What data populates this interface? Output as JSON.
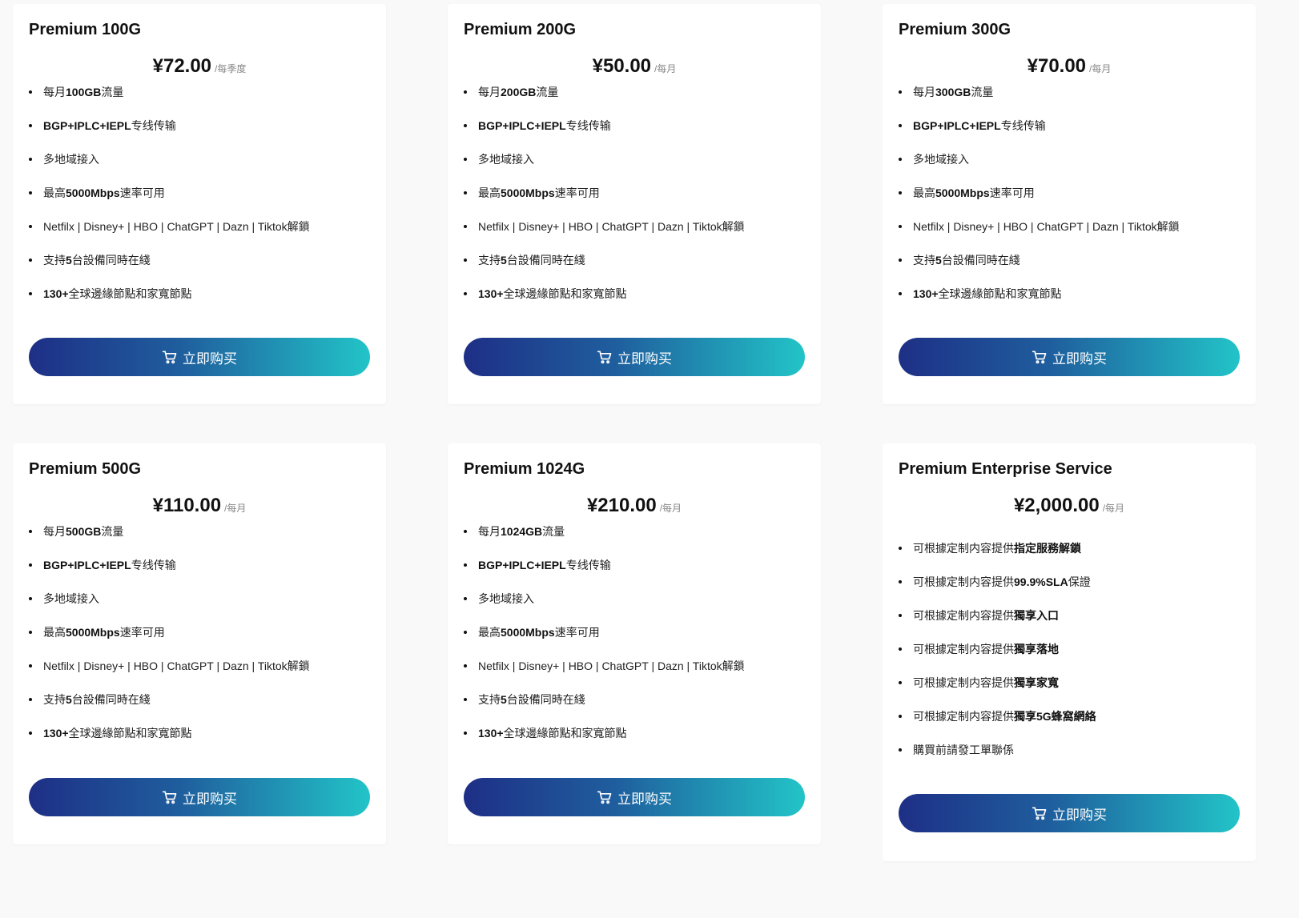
{
  "colors": {
    "button_gradient_start": "#1e2f86",
    "button_gradient_end": "#22c4c8",
    "background": "#f9f9f9",
    "card": "#ffffff"
  },
  "buy_label": "立即购买",
  "plans": [
    {
      "title": "Premium 100G",
      "price": "¥72.00",
      "period": "/每季度",
      "features": [
        {
          "pre": "每月",
          "bold": "100GB",
          "post": "流量"
        },
        {
          "pre": "",
          "bold": "BGP+IPLC+IEPL",
          "post": "专线传输"
        },
        {
          "pre": "多地域接入",
          "bold": "",
          "post": ""
        },
        {
          "pre": "最高",
          "bold": "5000Mbps",
          "post": "速率可用"
        },
        {
          "pre": "Netfilx | Disney+ | HBO | ChatGPT | Dazn | Tiktok解鎖",
          "bold": "",
          "post": ""
        },
        {
          "pre": "支持",
          "bold": "5",
          "post": "台設備同時在綫"
        },
        {
          "pre": "",
          "bold": "130+",
          "post": "全球邊緣節點和家寬節點"
        }
      ]
    },
    {
      "title": "Premium 200G",
      "price": "¥50.00",
      "period": "/每月",
      "features": [
        {
          "pre": "每月",
          "bold": "200GB",
          "post": "流量"
        },
        {
          "pre": "",
          "bold": "BGP+IPLC+IEPL",
          "post": "专线传输"
        },
        {
          "pre": "多地域接入",
          "bold": "",
          "post": ""
        },
        {
          "pre": "最高",
          "bold": "5000Mbps",
          "post": "速率可用"
        },
        {
          "pre": "Netfilx | Disney+ | HBO | ChatGPT | Dazn | Tiktok解鎖",
          "bold": "",
          "post": ""
        },
        {
          "pre": "支持",
          "bold": "5",
          "post": "台設備同時在綫"
        },
        {
          "pre": "",
          "bold": "130+",
          "post": "全球邊緣節點和家寬節點"
        }
      ]
    },
    {
      "title": "Premium 300G",
      "price": "¥70.00",
      "period": "/每月",
      "features": [
        {
          "pre": "每月",
          "bold": "300GB",
          "post": "流量"
        },
        {
          "pre": "",
          "bold": "BGP+IPLC+IEPL",
          "post": "专线传输"
        },
        {
          "pre": "多地域接入",
          "bold": "",
          "post": ""
        },
        {
          "pre": "最高",
          "bold": "5000Mbps",
          "post": "速率可用"
        },
        {
          "pre": "Netfilx | Disney+ | HBO | ChatGPT | Dazn | Tiktok解鎖",
          "bold": "",
          "post": ""
        },
        {
          "pre": "支持",
          "bold": "5",
          "post": "台設備同時在綫"
        },
        {
          "pre": "",
          "bold": "130+",
          "post": "全球邊緣節點和家寬節點"
        }
      ]
    },
    {
      "title": "Premium 500G",
      "price": "¥110.00",
      "period": "/每月",
      "features": [
        {
          "pre": "每月",
          "bold": "500GB",
          "post": "流量"
        },
        {
          "pre": "",
          "bold": "BGP+IPLC+IEPL",
          "post": "专线传输"
        },
        {
          "pre": "多地域接入",
          "bold": "",
          "post": ""
        },
        {
          "pre": "最高",
          "bold": "5000Mbps",
          "post": "速率可用"
        },
        {
          "pre": "Netfilx | Disney+ | HBO | ChatGPT | Dazn | Tiktok解鎖",
          "bold": "",
          "post": ""
        },
        {
          "pre": "支持",
          "bold": "5",
          "post": "台設備同時在綫"
        },
        {
          "pre": "",
          "bold": "130+",
          "post": "全球邊緣節點和家寬節點"
        }
      ]
    },
    {
      "title": "Premium 1024G",
      "price": "¥210.00",
      "period": "/每月",
      "features": [
        {
          "pre": "每月",
          "bold": "1024GB",
          "post": "流量"
        },
        {
          "pre": "",
          "bold": "BGP+IPLC+IEPL",
          "post": "专线传输"
        },
        {
          "pre": "多地域接入",
          "bold": "",
          "post": ""
        },
        {
          "pre": "最高",
          "bold": "5000Mbps",
          "post": "速率可用"
        },
        {
          "pre": "Netfilx | Disney+ | HBO | ChatGPT | Dazn | Tiktok解鎖",
          "bold": "",
          "post": ""
        },
        {
          "pre": "支持",
          "bold": "5",
          "post": "台設備同時在綫"
        },
        {
          "pre": "",
          "bold": "130+",
          "post": "全球邊緣節點和家寬節點"
        }
      ]
    },
    {
      "title": "Premium Enterprise Service",
      "price": "¥2,000.00",
      "period": "/每月",
      "features": [
        {
          "pre": "可根據定制内容提供",
          "bold": "指定服務解鎖",
          "post": ""
        },
        {
          "pre": "可根據定制内容提供",
          "bold": "99.9%SLA",
          "post": "保證"
        },
        {
          "pre": "可根據定制内容提供",
          "bold": "獨享入口",
          "post": ""
        },
        {
          "pre": "可根據定制内容提供",
          "bold": "獨享落地",
          "post": ""
        },
        {
          "pre": "可根據定制内容提供",
          "bold": "獨享家寬",
          "post": ""
        },
        {
          "pre": "可根據定制内容提供",
          "bold": "獨享5G蜂窩網絡",
          "post": ""
        },
        {
          "pre": "購買前請發工單聯係",
          "bold": "",
          "post": ""
        }
      ]
    }
  ]
}
